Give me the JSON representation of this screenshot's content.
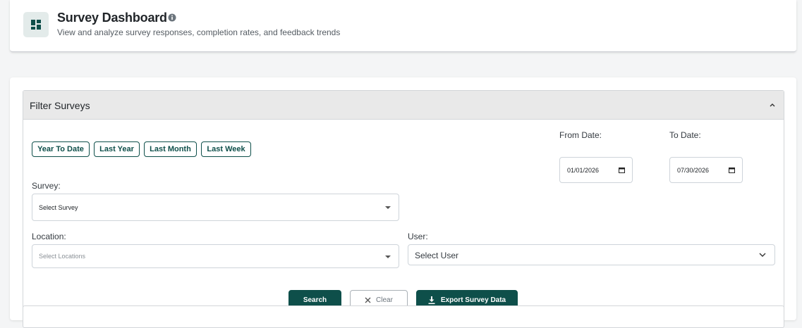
{
  "header": {
    "title": "Survey Dashboard",
    "subtitle": "View and analyze survey responses, completion rates, and feedback trends",
    "icon": "dashboard-icon",
    "info_icon": "info-icon"
  },
  "filter": {
    "title": "Filter Surveys",
    "quick_ranges": [
      "Year To Date",
      "Last Year",
      "Last Month",
      "Last Week"
    ],
    "from_date": {
      "label": "From Date:",
      "value": "01/01/2026"
    },
    "to_date": {
      "label": "To Date:",
      "value": "07/30/2026"
    },
    "survey": {
      "label": "Survey:",
      "placeholder": "Select Survey"
    },
    "location": {
      "label": "Location:",
      "placeholder": "Select Locations"
    },
    "user": {
      "label": "User:",
      "placeholder": "Select User"
    },
    "buttons": {
      "search": "Search",
      "clear": "Clear",
      "export": "Export Survey Data"
    }
  },
  "colors": {
    "accent": "#0e4f4a",
    "page_bg": "#f4f5f6",
    "panel_header_bg": "#e9e9e9"
  }
}
